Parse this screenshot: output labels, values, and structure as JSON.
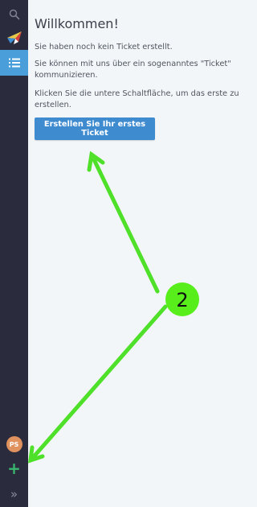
{
  "sidebar": {
    "items": [
      {
        "name": "search",
        "icon": "search-icon"
      },
      {
        "name": "logo",
        "icon": "logo-bird-icon"
      },
      {
        "name": "tickets-overview",
        "icon": "list-icon",
        "active": true
      }
    ],
    "avatar_initials": "PS",
    "add_icon": "plus-icon",
    "expand_icon": "double-chevron-right-icon",
    "colors": {
      "background": "#2a2b3d",
      "active": "#4a9fdb",
      "avatar": "#e0925e",
      "add": "#39b56d"
    }
  },
  "main": {
    "title": "Willkommen!",
    "paragraphs": [
      "Sie haben noch kein Ticket erstellt.",
      "Sie können mit uns über ein sogenanntes \"Ticket\" kommunizieren.",
      "Klicken Sie die untere Schaltfläche, um das erste zu erstellen."
    ],
    "cta_label": "Erstellen Sie Ihr erstes Ticket"
  },
  "annotation": {
    "step_number": "2",
    "color": "#4fe02a"
  }
}
